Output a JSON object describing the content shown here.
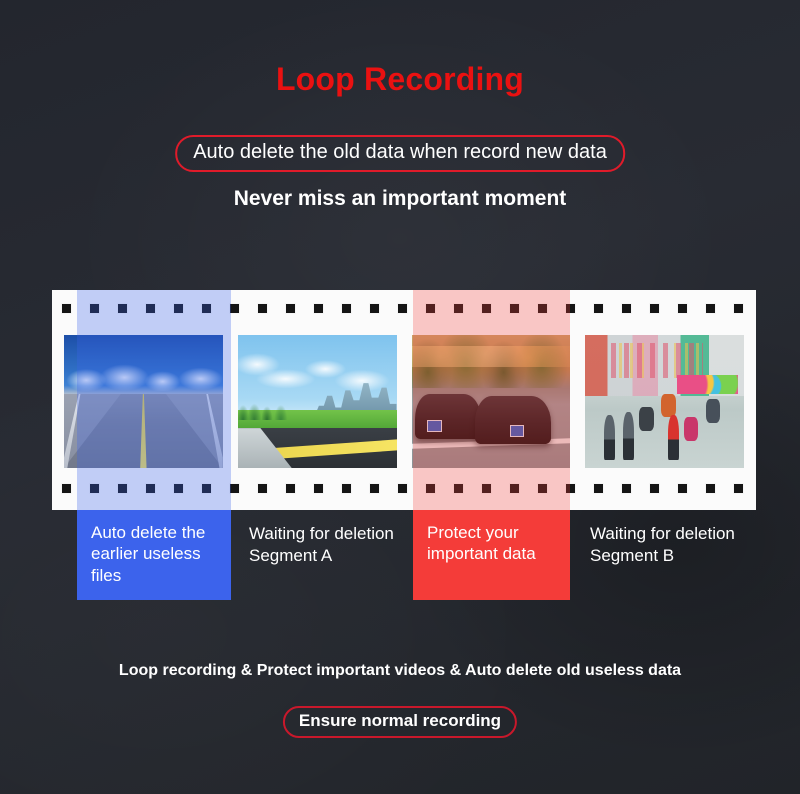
{
  "page": {
    "background_color": "#242730",
    "title": "Loop Recording",
    "title_color": "#ea1111",
    "tagline": "Auto delete the old data when record new data",
    "subhead": "Never miss an important moment"
  },
  "filmstrip": {
    "frame_count": 4,
    "frames": [
      {
        "scene": "empty highway over water",
        "caption": "Auto delete the\nearlier useless\nfiles",
        "highlight": "blue",
        "highlight_color": "#3c63ec"
      },
      {
        "scene": "highway with city skyline",
        "caption": "Waiting for deletion\nSegment A",
        "highlight": "none",
        "highlight_color": ""
      },
      {
        "scene": "two cars collision on street",
        "caption": "Protect your\nimportant data",
        "highlight": "red",
        "highlight_color": "#f43c39"
      },
      {
        "scene": "busy street with pedestrians and scooters",
        "caption": "Waiting for deletion\nSegment B",
        "highlight": "none",
        "highlight_color": ""
      }
    ]
  },
  "segments": {
    "blue": {
      "line1": "Auto delete the",
      "line2": "earlier useless",
      "line3": "files"
    },
    "red": {
      "line1": "Protect your",
      "line2": "important data"
    },
    "plain_a": {
      "line1": "Waiting for deletion",
      "line2": "Segment A"
    },
    "plain_b": {
      "line1": "Waiting for deletion",
      "line2": "Segment B"
    }
  },
  "footer": {
    "summary": "Loop recording & Protect important videos & Auto delete old useless data",
    "badge": "Ensure normal recording",
    "badge_border_color": "#c9182b"
  }
}
